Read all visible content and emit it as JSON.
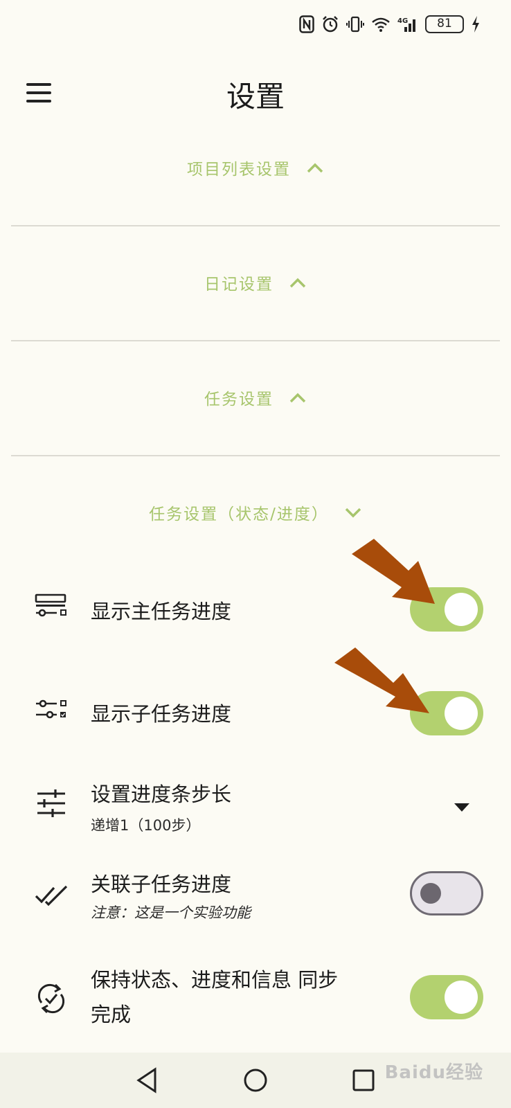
{
  "status_bar": {
    "battery_level": "81",
    "network_label": "4G",
    "icons": [
      "nfc-icon",
      "alarm-icon",
      "vibrate-icon",
      "wifi-icon",
      "signal-icon",
      "battery-icon",
      "charging-icon"
    ]
  },
  "header": {
    "title": "设置",
    "menu_icon": "hamburger-menu-icon"
  },
  "sections": [
    {
      "label": "项目列表设置",
      "state": "collapsed",
      "chevron": "chevron-up-icon"
    },
    {
      "label": "日记设置",
      "state": "collapsed",
      "chevron": "chevron-up-icon"
    },
    {
      "label": "任务设置",
      "state": "collapsed",
      "chevron": "chevron-up-icon"
    },
    {
      "label": "任务设置（状态/进度）",
      "state": "expanded",
      "chevron": "chevron-down-icon"
    }
  ],
  "settings": [
    {
      "title": "显示主任务进度",
      "control": "toggle",
      "checked": true,
      "icon": "progress-list-icon"
    },
    {
      "title": "显示子任务进度",
      "control": "toggle",
      "checked": true,
      "icon": "subtask-sliders-icon"
    },
    {
      "title": "设置进度条步长",
      "subtitle": "递增1（100步）",
      "control": "dropdown",
      "icon": "tune-icon"
    },
    {
      "title": "关联子任务进度",
      "subtitle": "注意：这是一个实验功能",
      "control": "toggle",
      "checked": false,
      "icon": "double-check-icon"
    },
    {
      "title": "保持状态、进度和信息 同步",
      "title_line2": "完成",
      "control": "toggle",
      "checked": true,
      "icon": "sync-check-icon"
    }
  ],
  "nav_bar": {
    "buttons": [
      "back-icon",
      "home-icon",
      "recents-icon"
    ]
  },
  "watermark": "Baidu经验",
  "colors": {
    "background": "#fcfbf4",
    "accent": "#a7c56c",
    "toggle_on": "#b3d16f",
    "toggle_off": "#e8e4ea",
    "annotation_arrow": "#a84c0a"
  }
}
